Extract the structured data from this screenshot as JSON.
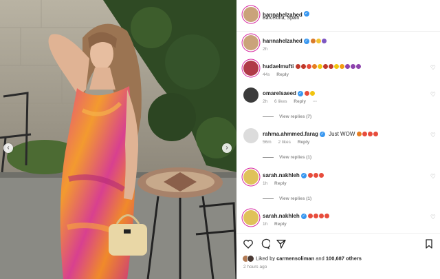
{
  "post": {
    "username": "hannahelzahed",
    "location": "Barcelona, Spain",
    "more_icon": "more-dots-icon"
  },
  "comments": [
    {
      "user": "hannahelzahed",
      "text": "",
      "time": "2h",
      "likes": "",
      "reply": "",
      "emoji_colors": [
        "#d97a2a",
        "#f2c230",
        "#7e57c2"
      ],
      "avatar_color": "#caa37a"
    },
    {
      "user": "hudaelmufti",
      "text": "",
      "time": "44s",
      "likes": "",
      "reply": "Reply",
      "emoji_colors": [
        "#c0392b",
        "#c0392b",
        "#e74c3c",
        "#e67e22",
        "#f1c40f",
        "#c0392b",
        "#c0392b",
        "#f1c40f",
        "#f39c12",
        "#8e44ad",
        "#8e44ad",
        "#8e44ad"
      ],
      "avatar_color": "#b03a48"
    },
    {
      "user": "omarelsaeed",
      "text": "",
      "time": "2h",
      "likes": "6 likes",
      "reply": "Reply",
      "emoji_colors": [
        "#e74c3c",
        "#f1c40f"
      ],
      "avatar_color": "#3b3b3b"
    },
    {
      "user": "rahma.ahmmed.farag",
      "text": "Just WOW",
      "time": "56m",
      "likes": "2 likes",
      "reply": "Reply",
      "emoji_colors": [
        "#e67e22",
        "#e74c3c",
        "#e74c3c",
        "#e74c3c"
      ],
      "avatar_color": "#dcdcdc"
    },
    {
      "user": "sarah.nakhleh",
      "text": "",
      "time": "1h",
      "likes": "",
      "reply": "Reply",
      "emoji_colors": [
        "#e74c3c",
        "#e74c3c",
        "#e74c3c"
      ],
      "avatar_color": "#e0c25a"
    },
    {
      "user": "sarah.nakhleh",
      "text": "",
      "time": "1h",
      "likes": "",
      "reply": "Reply",
      "emoji_colors": [
        "#e74c3c",
        "#e74c3c",
        "#e74c3c",
        "#e74c3c"
      ],
      "avatar_color": "#e0c25a"
    }
  ],
  "view_replies": [
    "View replies (7)",
    "View replies (1)",
    "View replies (1)"
  ],
  "likes": {
    "prefix": "Liked by",
    "user": "carmensoliman",
    "middle": "and",
    "count": "100,687 others"
  },
  "time_ago": "2 hours ago",
  "colors": {
    "verified": "#3897f0",
    "story_ring": "#d6249f",
    "dress_orange": "#f08a2a",
    "dress_pink": "#d93f8e"
  }
}
